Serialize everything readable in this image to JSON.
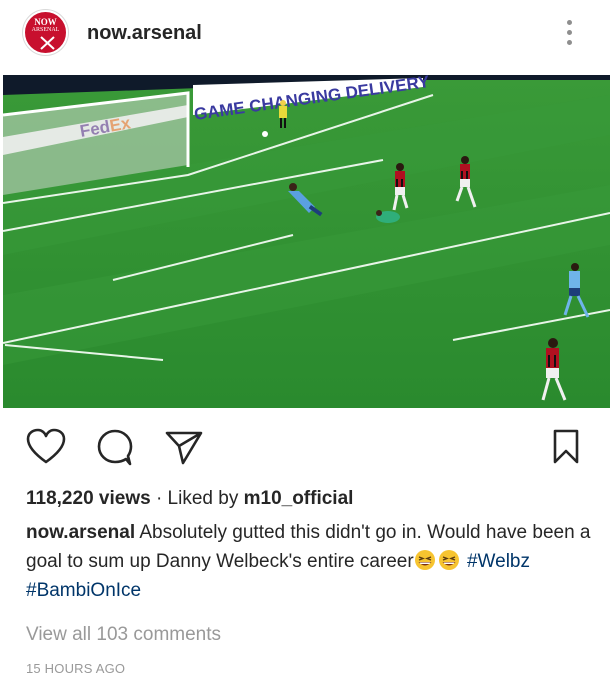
{
  "post": {
    "username": "now.arsenal",
    "avatar": {
      "line1": "NOW",
      "line2": "ARSENAL",
      "color": "#c8102e"
    },
    "menu_icon": "more-vertical-icon",
    "media": {
      "banner_text": "GAME CHANGING DELIVERY",
      "sponsor": "FedEx",
      "pitch_color": "#2d8c2f"
    },
    "actions": {
      "like_icon": "heart-icon",
      "comment_icon": "comment-icon",
      "share_icon": "share-icon",
      "save_icon": "bookmark-icon"
    },
    "views_count": "118,220 views",
    "views_separator": " · Liked by ",
    "liked_by": "m10_official",
    "caption": {
      "author": "now.arsenal",
      "text": " Absolutely gutted this didn't go in. Would have been a goal to sum up Danny Welbeck's entire career",
      "emoji": [
        "grinning-squinting-face",
        "grinning-squinting-face"
      ],
      "hashtags": [
        "#Welbz",
        "#BambiOnIce"
      ]
    },
    "view_comments": "View all 103 comments",
    "timestamp": "15 HOURS AGO"
  }
}
